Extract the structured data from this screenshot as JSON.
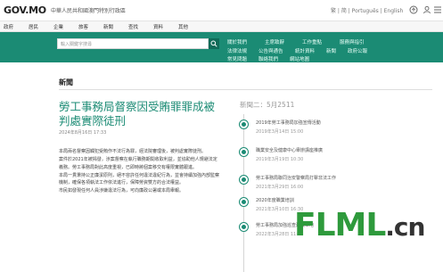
{
  "header": {
    "logo": "GOV.MO",
    "logo_sub": "中華人民共和國澳門特別行政區",
    "lang": "繁 | 简 | Português | English"
  },
  "nav": {
    "items": [
      "政府",
      "居民",
      "企業",
      "旅客",
      "新聞",
      "查找",
      "資料",
      "其他"
    ]
  },
  "search": {
    "placeholder": "輸入關鍵字搜尋"
  },
  "quick_links": [
    "關於我們",
    "主席致辭",
    "工作重點",
    "服務與指引",
    "法律法規",
    "公告與通告",
    "統計資料",
    "新聞",
    "政府公報",
    "常見問題",
    "聯絡我們",
    "網站地圖"
  ],
  "breadcrumb": "新聞",
  "article": {
    "title": "勞工事務局督察因受賄罪罪成被判處實際徒刑",
    "date": "2024年8月16日 17:33",
    "paragraphs": [
      "本局兩名督察因觸犯受賄作不法行為罪，經法院審理後，被判處實際徒刑。",
      "案件於2021年被揭發，涉案督察在執行職務期間收取利益，並協助他人規避法定義務。勞工事務局對此高度重視，已即時將個案移交有權限實體跟進。",
      "本局一貫秉持公正廉潔原則，絕不容許任何違法違紀行為，並會持續加強內部監察機制，確保各項執法工作依法進行，保障勞資雙方的合法權益。",
      "市民如發現任何人員涉嫌違法行為，可向廉政公署或本局舉報。"
    ]
  },
  "sidebar": {
    "title": "新聞二：5月2511",
    "items": [
      {
        "text": "2019年勞工事務局加強宣傳活動",
        "date": "2019年3月14日 15:00"
      },
      {
        "text": "職業安全及健康中心舉辦講座推廣",
        "date": "2019年3月19日 10:30"
      },
      {
        "text": "勞工事務局聯同治安警察局打擊非法工作",
        "date": "2021年3月29日 16:00"
      },
      {
        "text": "2020年度職業培訓",
        "date": "2021年3月10日 16:30"
      },
      {
        "text": "勞工事務局加強巡查建築工地",
        "date": "2022年3月28日 11:00"
      }
    ]
  },
  "watermark": {
    "main": "FLML",
    "suffix": ".cn"
  },
  "colors": {
    "brand": "#1b8b74",
    "brand_dark": "#0f6b58"
  }
}
